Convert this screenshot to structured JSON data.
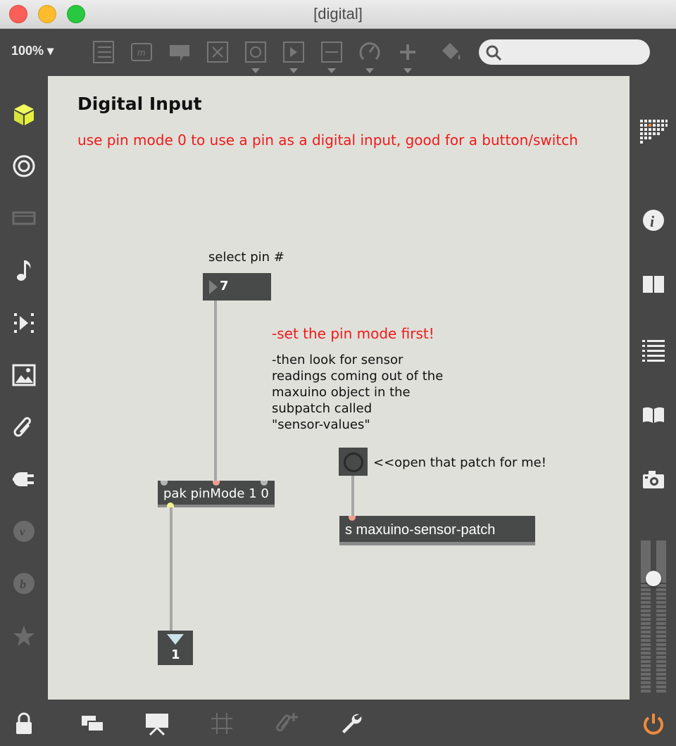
{
  "window": {
    "title": "[digital]"
  },
  "toolbar": {
    "zoom": "100%",
    "icons": [
      "patcher-list-icon",
      "message-box-icon",
      "comment-icon",
      "toggle-icon",
      "button-icon",
      "number-box-icon",
      "slider-icon",
      "dial-icon",
      "add-icon",
      "paint-bucket-icon"
    ],
    "search_placeholder": ""
  },
  "left_sidebar": [
    "cube-icon",
    "target-icon",
    "device-icon",
    "music-note-icon",
    "media-icon",
    "image-icon",
    "paperclip-icon",
    "plug-icon",
    "vst-icon",
    "bpatcher-icon",
    "star-icon"
  ],
  "right_sidebar": [
    "grid-icon",
    "info-icon",
    "book-columns-icon",
    "list-icon",
    "reference-book-icon",
    "camera-icon"
  ],
  "bottom_bar": [
    "lock-icon",
    "windows-icon",
    "presentation-icon",
    "grid-icon",
    "add-attachment-icon",
    "wrench-icon",
    "power-icon"
  ],
  "patch": {
    "heading": "Digital Input",
    "intro": "use pin mode 0 to use a pin as a digital input, good for a button/switch",
    "select_label": "select pin #",
    "pin_number": "7",
    "set_mode_note": "-set the pin mode first!",
    "sensor_note_lines": [
      "-then look for sensor",
      "readings coming out of the",
      "maxuino object in the",
      "subpatch called",
      "\"sensor-values\""
    ],
    "open_label": "<<open that patch for me!",
    "pak_object": "pak pinMode 1 0",
    "send_object": "s maxuino-sensor-patch",
    "output_number": "1"
  },
  "colors": {
    "accent": "#e6f23a",
    "annotation_red": "#ef1a1a",
    "canvas": "#e0e0da",
    "object_box": "#474a48",
    "power": "#f08a3c"
  }
}
